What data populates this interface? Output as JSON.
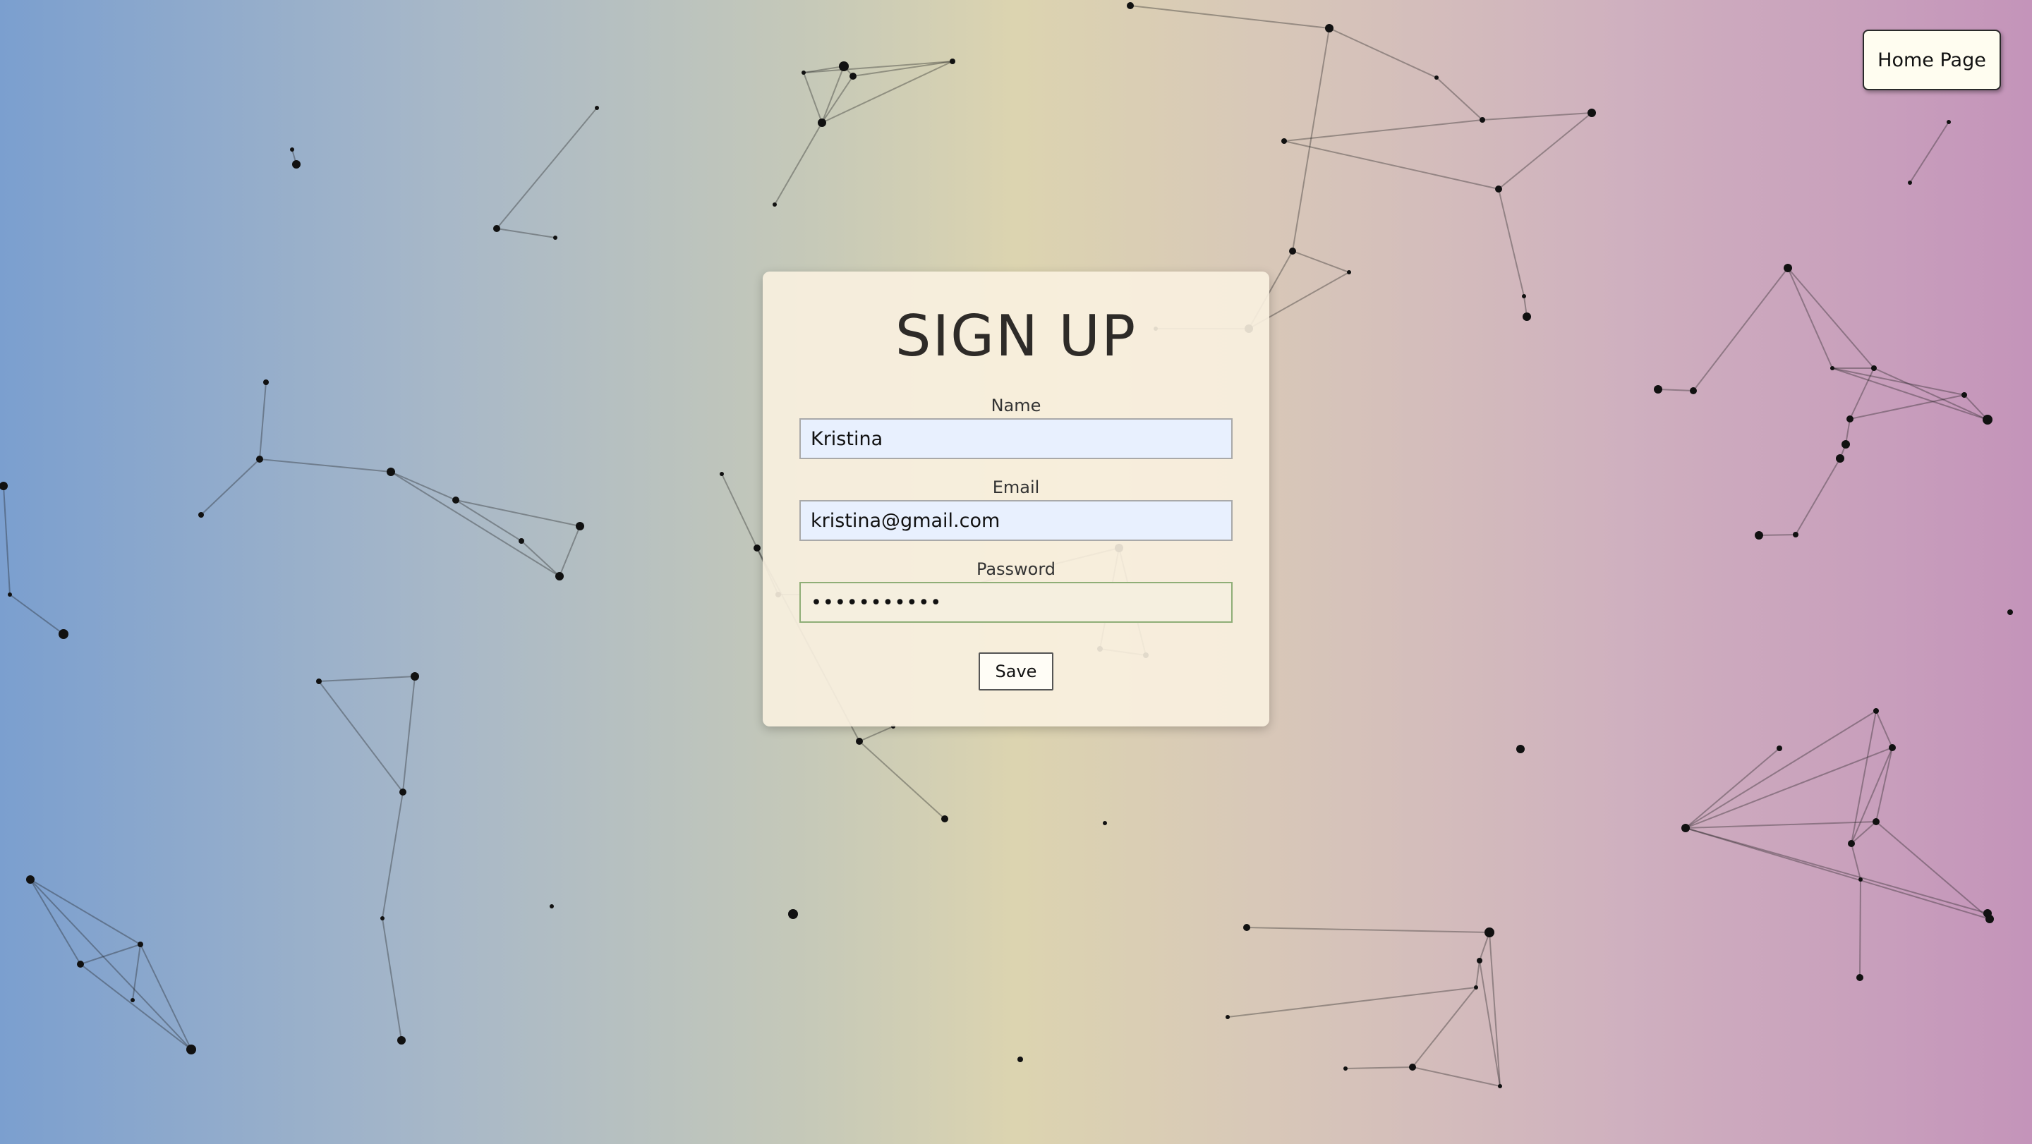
{
  "nav": {
    "home_label": "Home Page"
  },
  "signup": {
    "title": "SIGN UP",
    "name_label": "Name",
    "name_value": "Kristina",
    "email_label": "Email",
    "email_value": "kristina@gmail.com",
    "password_label": "Password",
    "password_value": "kristina123",
    "save_label": "Save"
  },
  "colors": {
    "gradient_left": "#7b9fcf",
    "gradient_center": "#dcd4b0",
    "gradient_right": "#c494ba",
    "card_background": "#f9f1e0",
    "input_autofill": "#e8f0fe",
    "password_border": "#8fae77"
  }
}
